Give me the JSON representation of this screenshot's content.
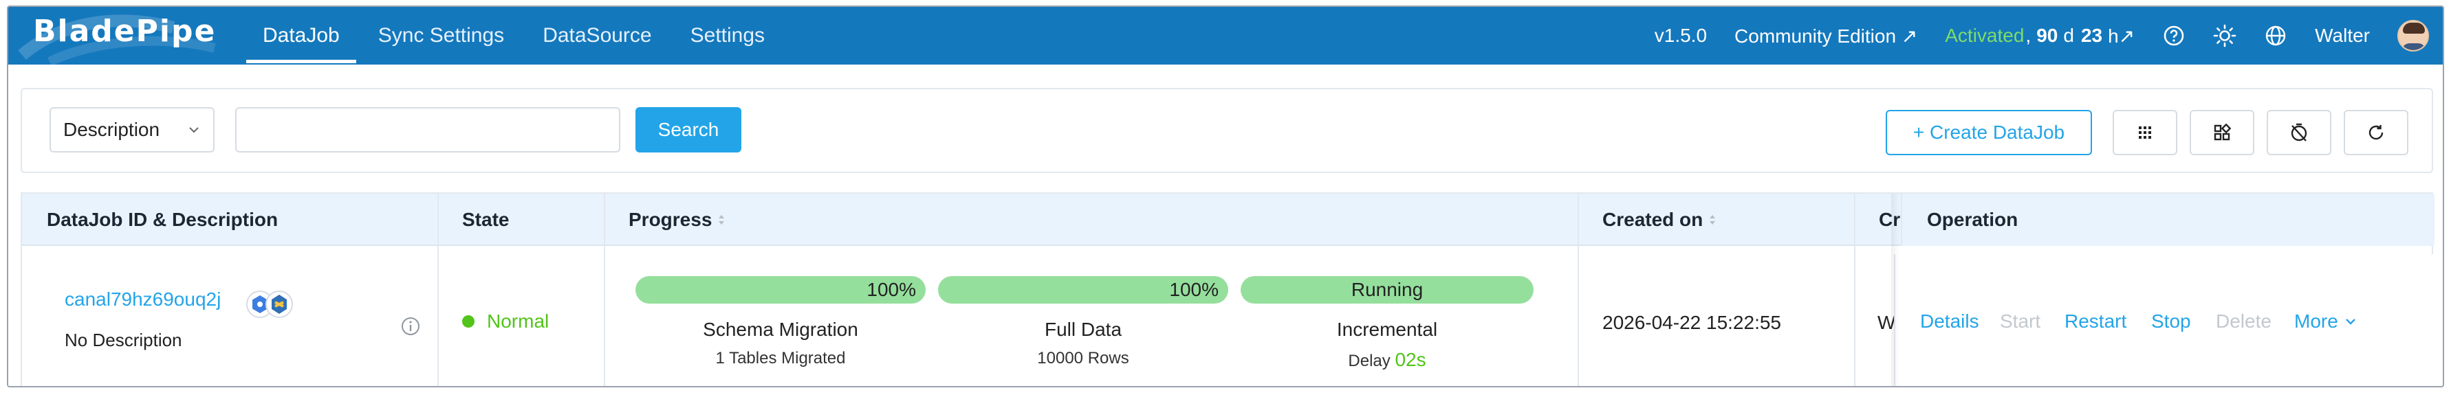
{
  "header": {
    "logo": "BladePipe",
    "nav": [
      "DataJob",
      "Sync Settings",
      "DataSource",
      "Settings"
    ],
    "version": "v1.5.0",
    "edition": "Community Edition ↗",
    "activated": "Activated",
    "remaining_prefix": ",",
    "days_num": "90",
    "days_unit": "d",
    "hours_num": "23",
    "hours_unit": "h↗",
    "user": "Walter",
    "icons": [
      "help-icon",
      "sun-icon",
      "globe-icon",
      "avatar"
    ]
  },
  "search": {
    "field_select": "Description",
    "input_value": "",
    "search_label": "Search",
    "create_label": "+ Create DataJob",
    "tool_icons": [
      "grid-icon",
      "apps-icon",
      "timer-off-icon",
      "refresh-icon"
    ]
  },
  "table": {
    "columns": [
      "DataJob ID & Description",
      "State",
      "Progress",
      "Created on",
      "Cr",
      "Operation"
    ],
    "rows": [
      {
        "job_id": "canal79hz69ouq2j",
        "description": "No Description",
        "state": "Normal",
        "progress": [
          {
            "bar_text": "100%",
            "percent": 100,
            "label": "Schema Migration",
            "sub": "1 Tables Migrated"
          },
          {
            "bar_text": "100%",
            "percent": 100,
            "label": "Full Data",
            "sub": "10000 Rows"
          },
          {
            "bar_text": "Running",
            "percent": 100,
            "label": "Incremental",
            "sub_prefix": "Delay",
            "sub_value": "02s"
          }
        ],
        "created_on": "2026-04-22 15:22:55",
        "creator_partial": "W",
        "operations": {
          "details": "Details",
          "start": "Start",
          "restart": "Restart",
          "stop": "Stop",
          "delete": "Delete",
          "more": "More"
        }
      }
    ]
  },
  "colors": {
    "header_bg": "#1478bd",
    "accent": "#23a4e8",
    "success": "#52c41a",
    "progress_fill": "#95df9d",
    "disabled": "#c3c8ce"
  }
}
